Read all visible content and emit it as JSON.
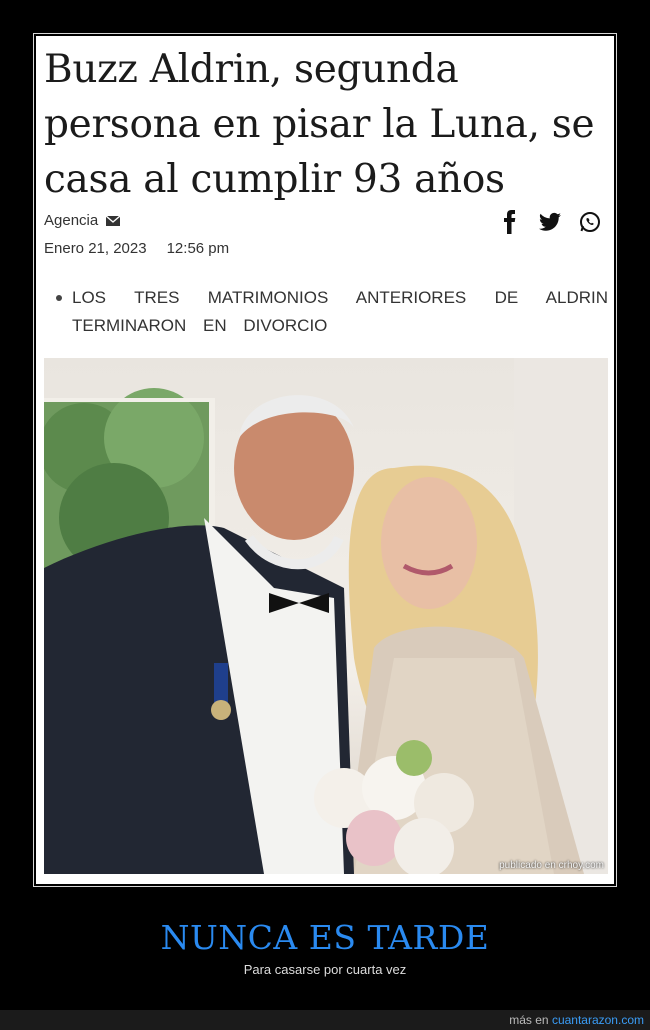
{
  "article": {
    "headline": "Buzz Aldrin, segunda persona en pisar la Luna, se casa al cumplir 93 años",
    "author": "Agencia",
    "date": "Enero 21, 2023",
    "time": "12:56 pm",
    "bullets": [
      "LOS TRES MATRIMONIOS ANTERIORES DE ALDRIN TERMINARON EN DIVORCIO"
    ],
    "photo_credit": "publicado en crhoy.com",
    "share_icons": [
      "facebook-icon",
      "twitter-icon",
      "whatsapp-icon"
    ]
  },
  "meme": {
    "title": "NUNCA ES TARDE",
    "subtitle": "Para casarse por cuarta vez"
  },
  "footer": {
    "prefix": "más en",
    "site": "cuantarazon.com"
  },
  "colors": {
    "background": "#000000",
    "meme_title": "#2a8af0",
    "footer_link": "#3a9cf5"
  }
}
